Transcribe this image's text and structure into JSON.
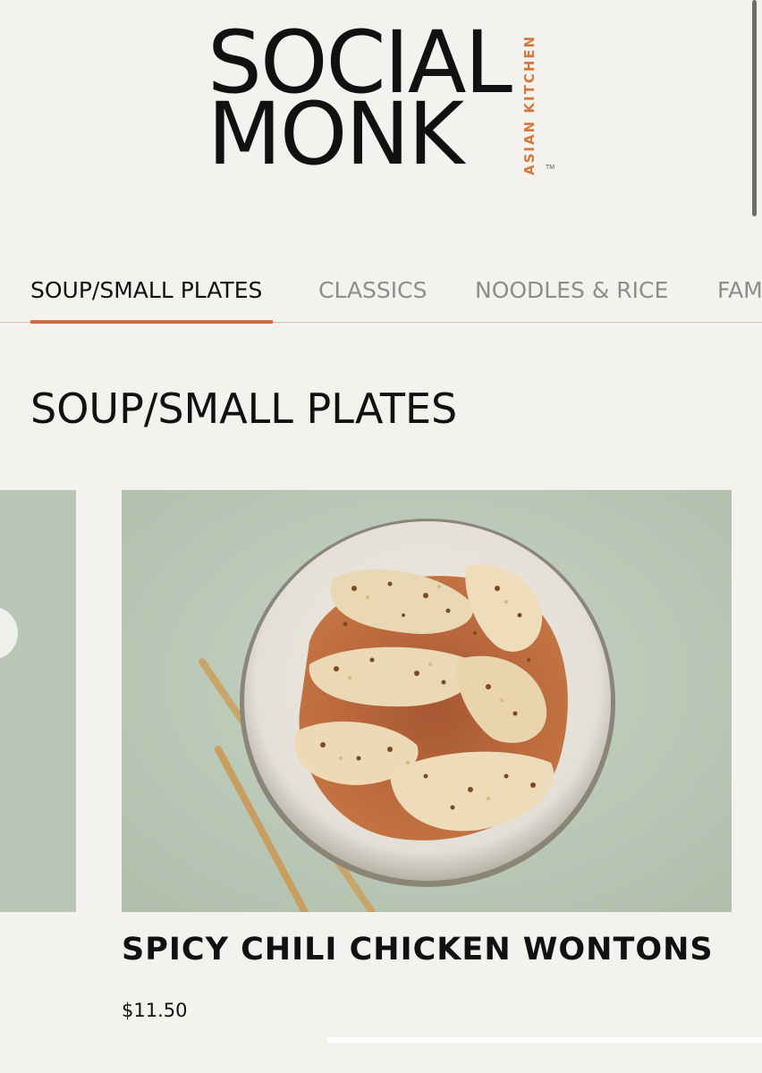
{
  "brand": {
    "line1": "SOCIAL",
    "line2": "MONK",
    "tagline": "ASIAN KITCHEN",
    "trademark": "TM",
    "accent_color": "#d07a3f"
  },
  "tabs": [
    {
      "label": "SOUP/SMALL PLATES",
      "active": true
    },
    {
      "label": "CLASSICS",
      "active": false
    },
    {
      "label": "NOODLES & RICE",
      "active": false
    },
    {
      "label": "FAM",
      "active": false
    }
  ],
  "active_tab_color": "#cf6b46",
  "section": {
    "title": "SOUP/SMALL PLATES"
  },
  "item": {
    "name": "SPICY CHILI CHICKEN WONTONS",
    "price": "$11.50",
    "image_icon": "wonton-plate-photo"
  }
}
